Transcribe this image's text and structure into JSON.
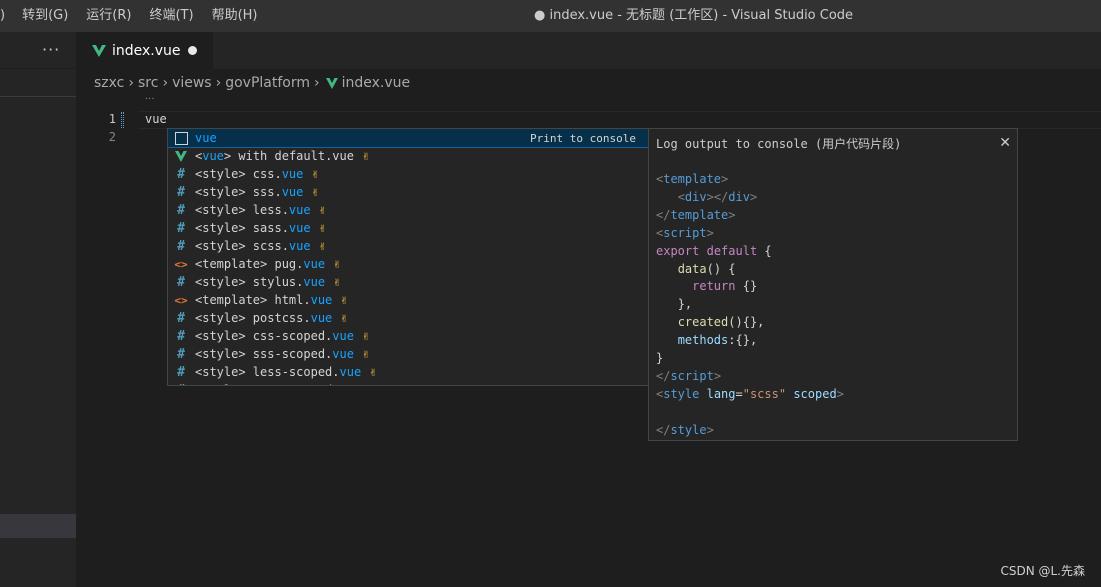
{
  "menu": [
    ")",
    "转到(G)",
    "运行(R)",
    "终端(T)",
    "帮助(H)"
  ],
  "window_title": "● index.vue - 无标题 (工作区) - Visual Studio Code",
  "sidebar": {
    "more_label": "···"
  },
  "tab": {
    "label": "index.vue"
  },
  "breadcrumb": [
    "szxc",
    "src",
    "views",
    "govPlatform",
    "index.vue"
  ],
  "editor": {
    "line_numbers": [
      "1",
      "2"
    ],
    "line1_text": "vue",
    "folded_dots": "···"
  },
  "suggest": {
    "selected": {
      "label": "vue",
      "detail": "Print to console"
    },
    "items": [
      {
        "icon": "vue-icon",
        "pre": "<",
        "hl": "vue",
        "post": "> with default.vue"
      },
      {
        "icon": "hash-icon",
        "pre": "<style> css.",
        "hl": "vue",
        "post": ""
      },
      {
        "icon": "hash-icon",
        "pre": "<style> sss.",
        "hl": "vue",
        "post": ""
      },
      {
        "icon": "hash-icon",
        "pre": "<style> less.",
        "hl": "vue",
        "post": ""
      },
      {
        "icon": "hash-icon",
        "pre": "<style> sass.",
        "hl": "vue",
        "post": ""
      },
      {
        "icon": "hash-icon",
        "pre": "<style> scss.",
        "hl": "vue",
        "post": ""
      },
      {
        "icon": "template-icon",
        "pre": "<template> pug.",
        "hl": "vue",
        "post": ""
      },
      {
        "icon": "hash-icon",
        "pre": "<style> stylus.",
        "hl": "vue",
        "post": ""
      },
      {
        "icon": "template-icon",
        "pre": "<template> html.",
        "hl": "vue",
        "post": ""
      },
      {
        "icon": "hash-icon",
        "pre": "<style> postcss.",
        "hl": "vue",
        "post": ""
      },
      {
        "icon": "hash-icon",
        "pre": "<style> css-scoped.",
        "hl": "vue",
        "post": ""
      },
      {
        "icon": "hash-icon",
        "pre": "<style> sss-scoped.",
        "hl": "vue",
        "post": ""
      },
      {
        "icon": "hash-icon",
        "pre": "<style> less-scoped.",
        "hl": "vue",
        "post": ""
      },
      {
        "icon": "hash-icon",
        "pre": "<style> sass-scoped.",
        "hl": "vue",
        "post": ""
      }
    ],
    "emoji": "✌"
  },
  "details": {
    "title": "Log output to console (用户代码片段)",
    "close_label": "✕"
  },
  "watermark": "CSDN @L.先森",
  "colors": {
    "editor_bg": "#1e1e1e",
    "titlebar_bg": "#323233",
    "sidebar_bg": "#252526",
    "suggest_selected_bg": "#062f4a",
    "highlight_blue": "#18a3ff",
    "vue_green": "#41b883"
  }
}
